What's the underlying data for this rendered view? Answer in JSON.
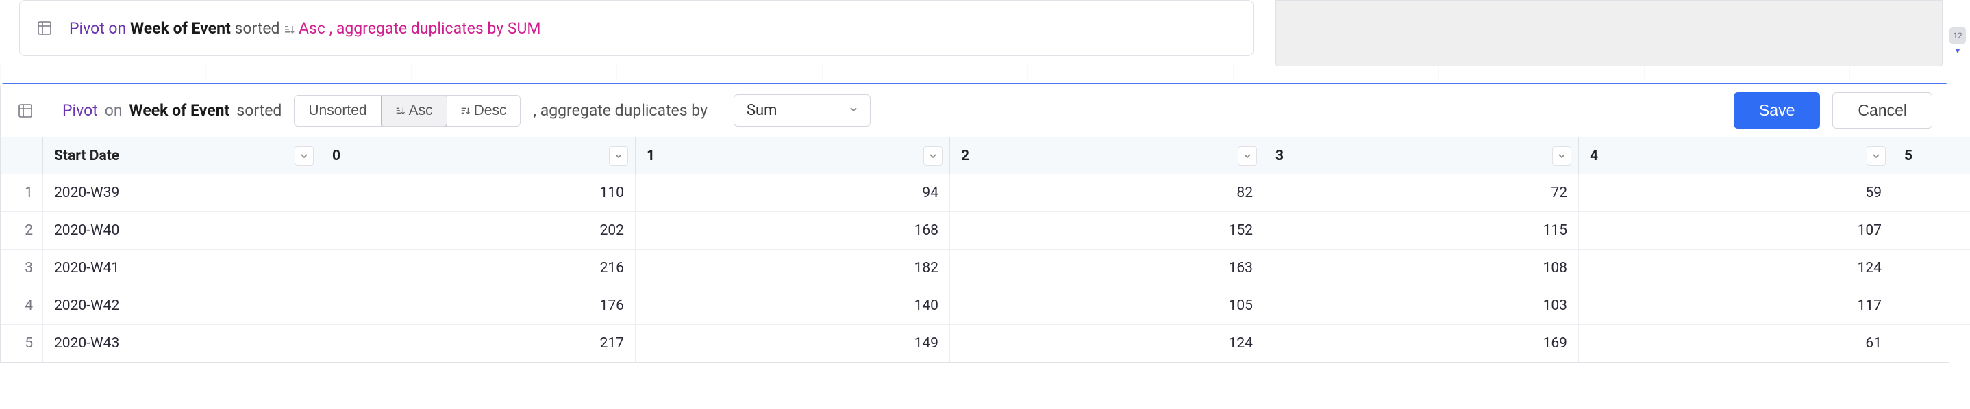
{
  "summary": {
    "prefix": "Pivot on",
    "field": "Week of Event",
    "sorted": "sorted",
    "direction": "Asc",
    "agg_phrase": ", aggregate duplicates by",
    "agg_value": "SUM"
  },
  "editor": {
    "pivot": "Pivot",
    "on": "on",
    "field": "Week of Event",
    "sorted": "sorted",
    "buttons": {
      "unsorted": "Unsorted",
      "asc": "Asc",
      "desc": "Desc"
    },
    "agg_phrase": ", aggregate duplicates by",
    "agg_selected": "Sum",
    "save": "Save",
    "cancel": "Cancel"
  },
  "badge": {
    "count": "12"
  },
  "table": {
    "columns": [
      "Start Date",
      "0",
      "1",
      "2",
      "3",
      "4",
      "5"
    ],
    "rows": [
      {
        "n": "1",
        "label": "2020-W39",
        "v": [
          "110",
          "94",
          "82",
          "72",
          "59",
          ""
        ]
      },
      {
        "n": "2",
        "label": "2020-W40",
        "v": [
          "202",
          "168",
          "152",
          "115",
          "107",
          ""
        ]
      },
      {
        "n": "3",
        "label": "2020-W41",
        "v": [
          "216",
          "182",
          "163",
          "108",
          "124",
          ""
        ]
      },
      {
        "n": "4",
        "label": "2020-W42",
        "v": [
          "176",
          "140",
          "105",
          "103",
          "117",
          ""
        ]
      },
      {
        "n": "5",
        "label": "2020-W43",
        "v": [
          "217",
          "149",
          "124",
          "169",
          "61",
          ""
        ]
      }
    ]
  }
}
